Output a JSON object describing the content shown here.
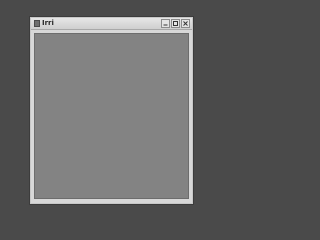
{
  "window": {
    "title": "Irri"
  },
  "titlebar": {
    "buttons": [
      {
        "name": "minimize",
        "icon": "minimize-icon"
      },
      {
        "name": "maximize",
        "icon": "maximize-icon"
      },
      {
        "name": "close",
        "icon": "close-icon"
      }
    ]
  },
  "colors": {
    "desktop": "#4a4a4a",
    "client_area": "#838383",
    "frame": "#d8d8d8"
  }
}
